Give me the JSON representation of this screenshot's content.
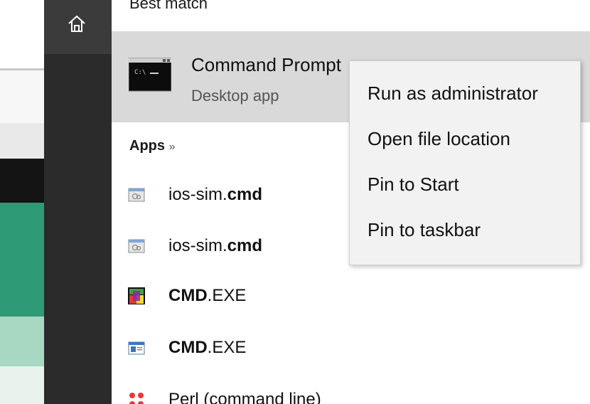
{
  "rail": {
    "home_icon": "home-icon"
  },
  "best_match": {
    "title": "Best match",
    "name": "Command Prompt",
    "subtitle": "Desktop app",
    "icon": "command-prompt-icon"
  },
  "apps": {
    "title": "Apps",
    "more": "»",
    "items": [
      {
        "prefix": "ios-sim.",
        "bold": "cmd",
        "suffix": "",
        "icon": "script-file-icon"
      },
      {
        "prefix": "ios-sim.",
        "bold": "cmd",
        "suffix": "",
        "icon": "script-file-icon"
      },
      {
        "prefix": "",
        "bold": "CMD",
        "suffix": ".EXE",
        "icon": "colorful-exe-icon"
      },
      {
        "prefix": "",
        "bold": "CMD",
        "suffix": ".EXE",
        "icon": "window-app-icon"
      },
      {
        "prefix": "Perl (command line)",
        "bold": "",
        "suffix": "",
        "icon": "perl-dots-icon"
      }
    ]
  },
  "context_menu": {
    "items": [
      {
        "label": "Run as administrator"
      },
      {
        "label": "Open file location"
      },
      {
        "label": "Pin to Start"
      },
      {
        "label": "Pin to taskbar"
      }
    ]
  },
  "colors": {
    "rail": "#2b2b2b",
    "rail_top": "#3b3b3b",
    "best_match_bg": "#d9d9d9",
    "menu_bg": "#f2f2f2",
    "desktop_green": "#2f9a76"
  }
}
